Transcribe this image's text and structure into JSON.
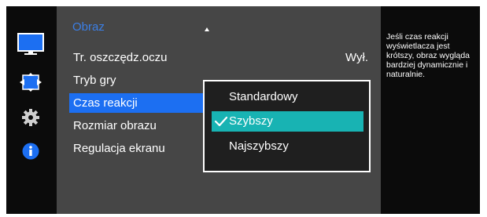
{
  "menu": {
    "title": "Obraz",
    "items": [
      {
        "label": "Tr. oszczędz.oczu",
        "value": "Wył."
      },
      {
        "label": "Tryb gry",
        "value": ""
      },
      {
        "label": "Czas reakcji",
        "value": "",
        "selected": true
      },
      {
        "label": "Rozmiar obrazu",
        "value": ""
      },
      {
        "label": "Regulacja ekranu",
        "value": ""
      }
    ]
  },
  "submenu": {
    "options": [
      {
        "label": "Standardowy",
        "checked": false
      },
      {
        "label": "Szybszy",
        "checked": true
      },
      {
        "label": "Najszybszy",
        "checked": false
      }
    ]
  },
  "info": {
    "text": "Jeśli czas reakcji wyświetlacza jest krótszy, obraz wygląda bardziej dynamicznie i naturalnie."
  },
  "sidebar": {
    "icons": [
      "monitor-icon",
      "move-arrows-icon",
      "gear-icon",
      "info-icon"
    ],
    "active": "monitor-icon"
  },
  "colors": {
    "accent_blue": "#1c6ff2",
    "title_blue": "#3b7fe6",
    "highlight_teal": "#18b3b3",
    "panel_gray": "#464646"
  }
}
